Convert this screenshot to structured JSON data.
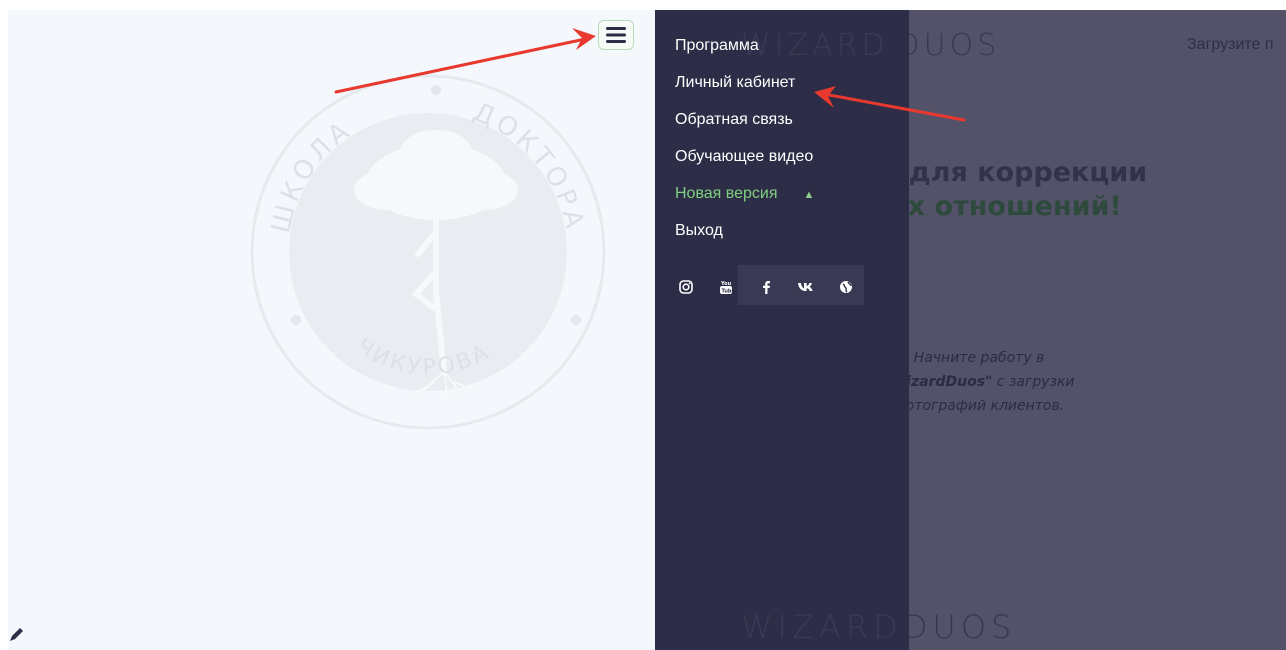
{
  "brand": {
    "name_left": "WIZARD",
    "name_right": "DUOS"
  },
  "header": {
    "upload_label": "Загрузите п"
  },
  "hero": {
    "line1": "Программа для коррекции",
    "line2": "гармических отношений!"
  },
  "hint": {
    "line1": "Начните работу в",
    "brand": "\"WizardDuos\"",
    "line2_rest": " с загрузки",
    "line3": "фотографий клиентов."
  },
  "logo": {
    "text_top_left": "ШКОЛА",
    "text_top_right": "ДОКТОРА",
    "text_bottom": "ЧИКУРОВА"
  },
  "menu": {
    "items": [
      {
        "label": "Программа"
      },
      {
        "label": "Личный кабинет"
      },
      {
        "label": "Обратная связь"
      },
      {
        "label": "Обучающее видео"
      },
      {
        "label": "Новая версия"
      },
      {
        "label": "Выход"
      }
    ]
  },
  "socials": [
    "instagram-icon",
    "youtube-icon",
    "facebook-icon",
    "vk-icon",
    "globe-icon"
  ],
  "colors": {
    "drawer_bg": "#2e2d47",
    "accent_green": "#7fd07f",
    "overlay": "#535269",
    "annotation_red": "#e8392f"
  }
}
